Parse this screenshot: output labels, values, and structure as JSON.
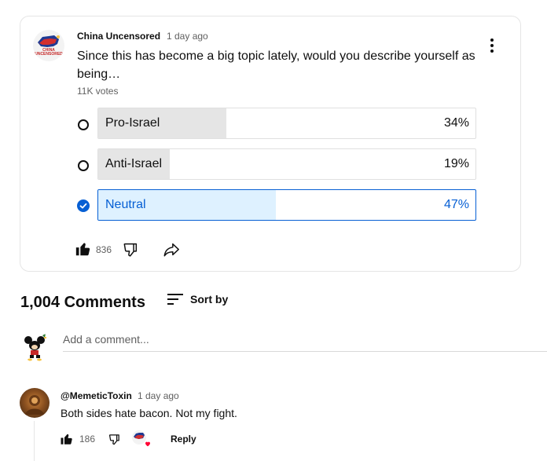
{
  "post": {
    "channel": "China Uncensored",
    "time": "1 day ago",
    "question": "Since this has become a big topic lately, would you describe yourself as being…",
    "votes": "11K votes",
    "avatar_text": "CHINA UNCENSORED",
    "options": [
      {
        "label": "Pro-Israel",
        "percent": "34%",
        "fill": 0.34,
        "selected": false
      },
      {
        "label": "Anti-Israel",
        "percent": "19%",
        "fill": 0.19,
        "selected": false
      },
      {
        "label": "Neutral",
        "percent": "47%",
        "fill": 0.47,
        "selected": true
      }
    ],
    "likes": "836"
  },
  "comments_header": {
    "title": "1,004 Comments",
    "sort_label": "Sort by"
  },
  "add_comment": {
    "placeholder": "Add a comment..."
  },
  "comment": {
    "author": "@MemeticToxin",
    "time": "1 day ago",
    "text": "Both sides hate bacon. Not my fight.",
    "likes": "186",
    "reply_label": "Reply"
  },
  "colors": {
    "accent": "#065fd4",
    "selected_fill": "#def1ff",
    "bar_fill": "#e5e5e5",
    "secondary_text": "#606060",
    "heart": "#ff0033"
  }
}
